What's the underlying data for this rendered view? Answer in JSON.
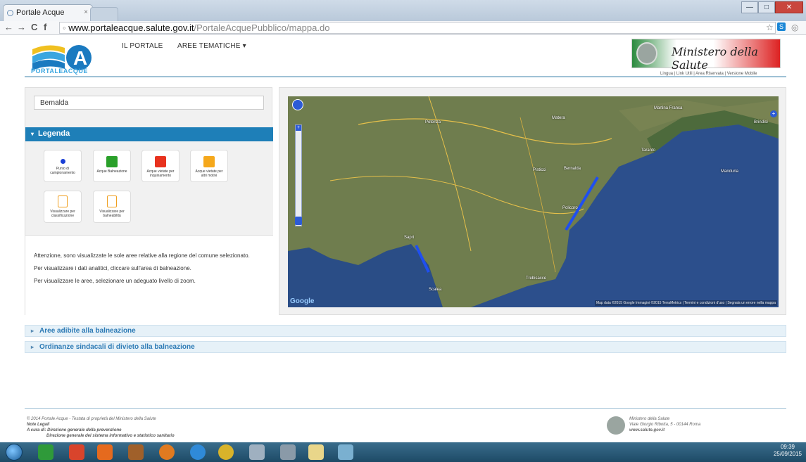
{
  "browser": {
    "tab_title": "Portale Acque",
    "tab_close": "×",
    "url_host": "www.portaleacque.salute.gov.it",
    "url_path": "/PortaleAcquePubblico/mappa.do",
    "back": "←",
    "forward": "→",
    "reload": "C",
    "home": "f"
  },
  "header": {
    "logo_text": "PORTALEACQUE",
    "nav": [
      {
        "label": "IL PORTALE"
      },
      {
        "label": "AREE TEMATICHE ▾"
      }
    ],
    "ministero": "Ministero della Salute",
    "util_links": "Lingua | Link Utili | Area Riservata | Versione Mobile"
  },
  "left": {
    "search_value": "Bernalda",
    "legenda_title": "Legenda",
    "legend": [
      {
        "label": "Punto di campionamento",
        "color": "#1a3fd6",
        "kind": "dot"
      },
      {
        "label": "Acque Balneazione",
        "color": "#2aa02a",
        "kind": "swatch"
      },
      {
        "label": "Acque vietate per inquinamento",
        "color": "#e8321e",
        "kind": "swatch"
      },
      {
        "label": "Acque vietate per altri motivi",
        "color": "#f5a81c",
        "kind": "swatch"
      },
      {
        "label": "Visualizzare per classificazione",
        "color": "#f0a020",
        "kind": "file"
      },
      {
        "label": "Visualizzare per balneabilità",
        "color": "#f0a020",
        "kind": "file"
      }
    ],
    "notes": [
      "Attenzione, sono visualizzate le sole aree relative alla regione del comune selezionato.",
      "Per visualizzare i dati analitici, cliccare sull'area di balneazione.",
      "Per visualizzare le aree, selezionare un adeguato livello di zoom."
    ]
  },
  "map": {
    "copyright": "Map data ©2015 Google Immagini ©2015 TerraMetrics | Termini e condizioni d'uso | Segnala un errore nella mappa",
    "google": "Google",
    "places": [
      {
        "name": "Potenza"
      },
      {
        "name": "Matera"
      },
      {
        "name": "Taranto"
      },
      {
        "name": "Brindisi"
      },
      {
        "name": "Martina Franca"
      },
      {
        "name": "Policoro"
      },
      {
        "name": "Scalea"
      },
      {
        "name": "Sapri"
      },
      {
        "name": "Trebisacce"
      },
      {
        "name": "Manduria"
      },
      {
        "name": "Pisticci"
      },
      {
        "name": "Bernalda"
      }
    ]
  },
  "accordions": [
    {
      "label": "Aree adibite alla balneazione"
    },
    {
      "label": "Ordinanze sindacali di divieto alla balneazione"
    }
  ],
  "footer": {
    "line1": "© 2014 Portale Acque - Testata di proprietà del Ministero della Salute",
    "line2": "Note Legali",
    "line3": "A cura di: Direzione generale della prevenzione",
    "line4": "Direzione generale del sistema informativo e statistico sanitario",
    "min_name": "Ministero della Salute",
    "min_addr": "Viale Giorgio Ribotta, 5 - 00144 Roma",
    "min_site": "www.salute.gov.it"
  },
  "tray": {
    "time": "09:39",
    "date": "25/09/2015"
  }
}
